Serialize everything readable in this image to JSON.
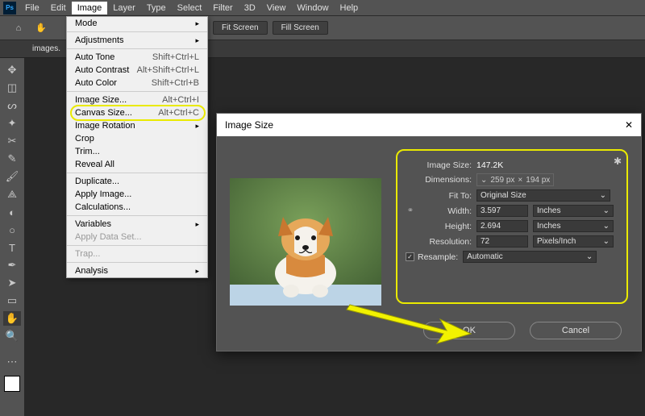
{
  "menubar": {
    "items": [
      "File",
      "Edit",
      "Image",
      "Layer",
      "Type",
      "Select",
      "Filter",
      "3D",
      "View",
      "Window",
      "Help"
    ],
    "active_index": 2
  },
  "optbar": {
    "fit_screen": "Fit Screen",
    "fill_screen": "Fill Screen"
  },
  "tab": {
    "label": "images."
  },
  "dropdown": {
    "mode": "Mode",
    "adjustments": "Adjustments",
    "auto_tone": "Auto Tone",
    "auto_tone_sc": "Shift+Ctrl+L",
    "auto_contrast": "Auto Contrast",
    "auto_contrast_sc": "Alt+Shift+Ctrl+L",
    "auto_color": "Auto Color",
    "auto_color_sc": "Shift+Ctrl+B",
    "image_size": "Image Size...",
    "image_size_sc": "Alt+Ctrl+I",
    "canvas_size": "Canvas Size...",
    "canvas_size_sc": "Alt+Ctrl+C",
    "image_rotation": "Image Rotation",
    "crop": "Crop",
    "trim": "Trim...",
    "reveal_all": "Reveal All",
    "duplicate": "Duplicate...",
    "apply_image": "Apply Image...",
    "calculations": "Calculations...",
    "variables": "Variables",
    "apply_data_set": "Apply Data Set...",
    "trap": "Trap...",
    "analysis": "Analysis"
  },
  "dialog": {
    "title": "Image Size",
    "image_size_lbl": "Image Size:",
    "image_size_val": "147.2K",
    "dimensions_lbl": "Dimensions:",
    "dim_w": "259 px",
    "dim_h": "194 px",
    "fit_to_lbl": "Fit To:",
    "fit_to_val": "Original Size",
    "width_lbl": "Width:",
    "width_val": "3.597",
    "width_unit": "Inches",
    "height_lbl": "Height:",
    "height_val": "2.694",
    "height_unit": "Inches",
    "resolution_lbl": "Resolution:",
    "resolution_val": "72",
    "resolution_unit": "Pixels/Inch",
    "resample_lbl": "Resample:",
    "resample_val": "Automatic",
    "resample_checked": "✓",
    "ok": "OK",
    "cancel": "Cancel"
  },
  "icons": {
    "home": "⌂",
    "hand": "✋",
    "close": "✕",
    "submenu": "▸",
    "dropdown": "⌄",
    "times": "×",
    "gear": "✱",
    "link": "⚭"
  }
}
